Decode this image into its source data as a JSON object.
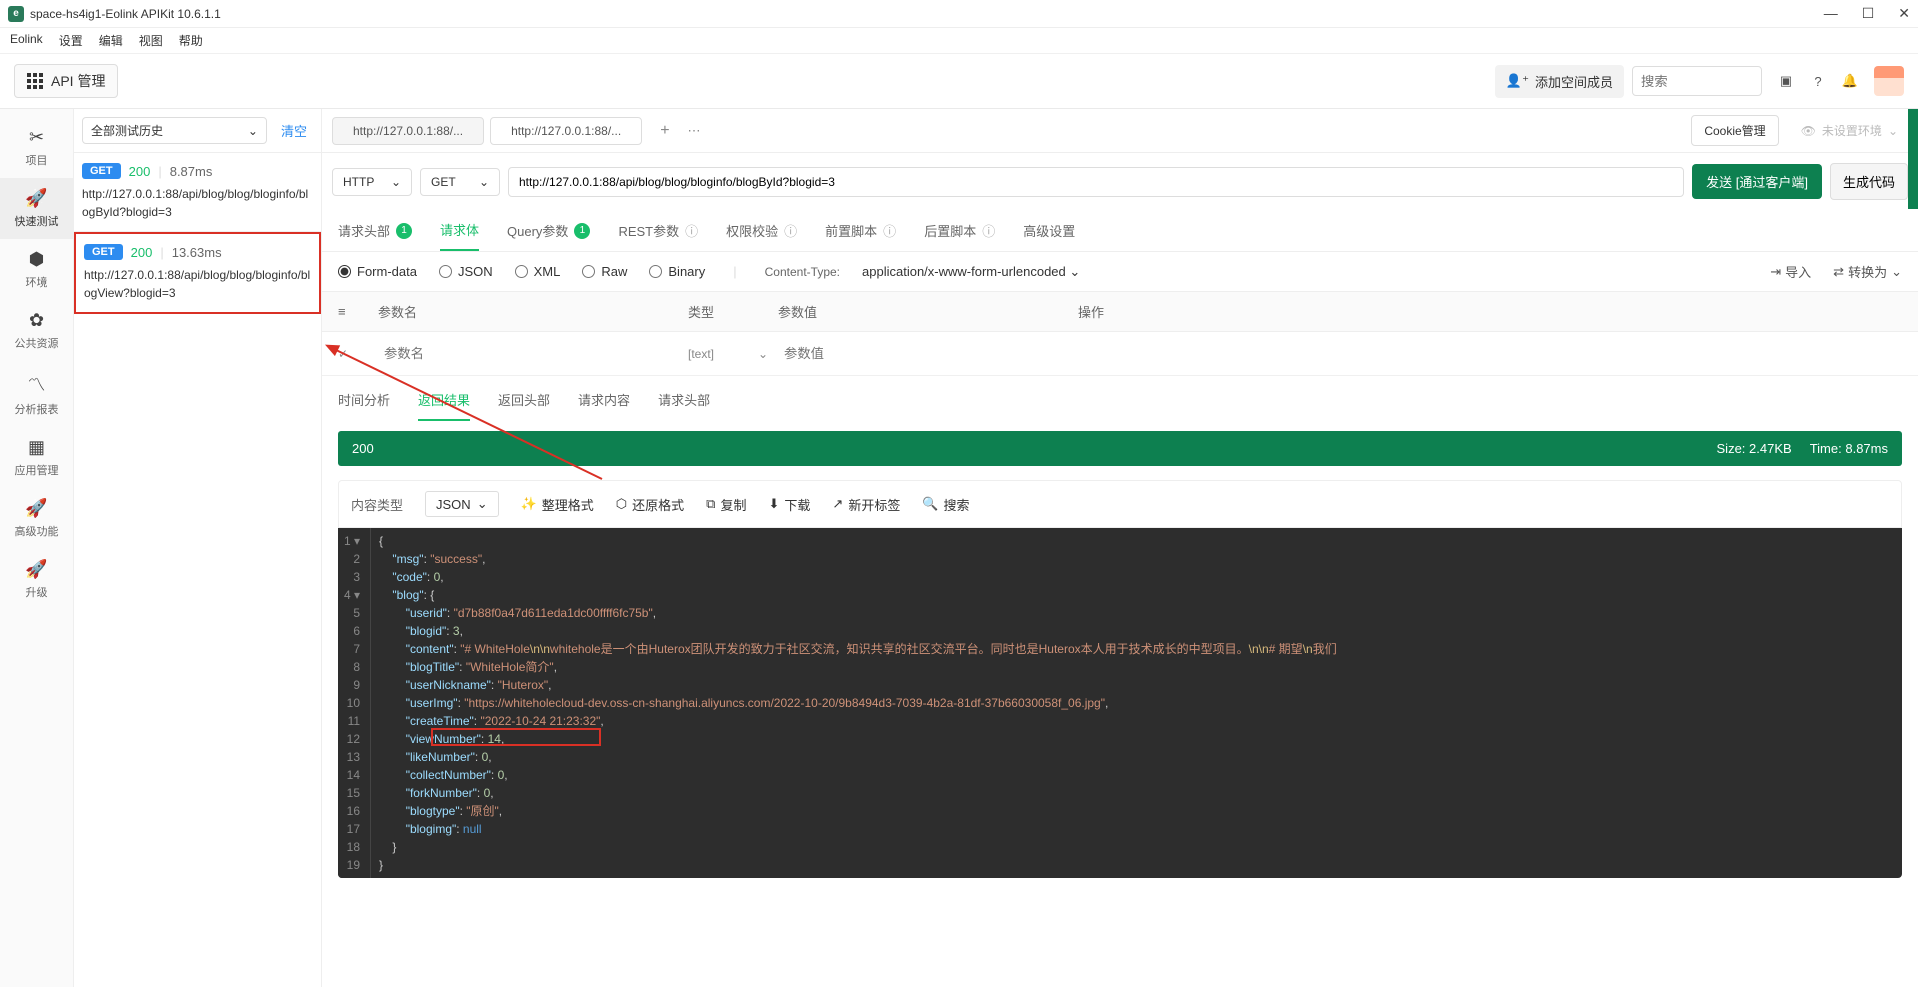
{
  "window": {
    "title": "space-hs4ig1-Eolink APIKit 10.6.1.1",
    "menu": [
      "Eolink",
      "设置",
      "编辑",
      "视图",
      "帮助"
    ]
  },
  "toolbar": {
    "api_mgmt": "API 管理",
    "add_member": "添加空间成员",
    "search_placeholder": "搜索"
  },
  "rail": [
    {
      "icon": "✕",
      "label": "项目"
    },
    {
      "icon": "🚀",
      "label": "快速测试"
    },
    {
      "icon": "⬡",
      "label": "环境"
    },
    {
      "icon": "⚙",
      "label": "公共资源"
    },
    {
      "icon": "📈",
      "label": "分析报表"
    },
    {
      "icon": "▦",
      "label": "应用管理"
    },
    {
      "icon": "🚀",
      "label": "高级功能"
    },
    {
      "icon": "🚀",
      "label": "升级"
    }
  ],
  "history": {
    "filter": "全部测试历史",
    "clear": "清空",
    "items": [
      {
        "method": "GET",
        "status": "200",
        "time": "8.87ms",
        "url": "http://127.0.0.1:88/api/blog/blog/bloginfo/blogById?blogid=3"
      },
      {
        "method": "GET",
        "status": "200",
        "time": "13.63ms",
        "url": "http://127.0.0.1:88/api/blog/blog/bloginfo/blogView?blogid=3"
      }
    ]
  },
  "tabs": {
    "items": [
      "http://127.0.0.1:88/...",
      "http://127.0.0.1:88/..."
    ],
    "cookie": "Cookie管理",
    "env": "未设置环境"
  },
  "request": {
    "protocol": "HTTP",
    "method": "GET",
    "url": "http://127.0.0.1:88/api/blog/blog/bloginfo/blogById?blogid=3",
    "send": "发送 [通过客户端]",
    "gen_code": "生成代码",
    "tabs": {
      "headers": "请求头部",
      "headers_badge": "1",
      "body": "请求体",
      "query": "Query参数",
      "query_badge": "1",
      "rest": "REST参数",
      "auth": "权限校验",
      "pre": "前置脚本",
      "post": "后置脚本",
      "advanced": "高级设置"
    },
    "body_types": [
      "Form-data",
      "JSON",
      "XML",
      "Raw",
      "Binary"
    ],
    "content_type_label": "Content-Type:",
    "content_type_value": "application/x-www-form-urlencoded",
    "import": "导入",
    "convert": "转换为",
    "params_header": {
      "name": "参数名",
      "type": "类型",
      "value": "参数值",
      "action": "操作"
    },
    "param_placeholder": {
      "name": "参数名",
      "type": "[text]",
      "value": "参数值"
    }
  },
  "response": {
    "tabs": [
      "时间分析",
      "返回结果",
      "返回头部",
      "请求内容",
      "请求头部"
    ],
    "status_code": "200",
    "size_label": "Size:",
    "size": "2.47KB",
    "time_label": "Time:",
    "time": "8.87ms",
    "content_type_label": "内容类型",
    "format": "JSON",
    "actions": {
      "tidy": "整理格式",
      "restore": "还原格式",
      "copy": "复制",
      "download": "下载",
      "newtab": "新开标签",
      "search": "搜索"
    }
  },
  "json_body": {
    "msg": "success",
    "code": 0,
    "blog": {
      "userid": "d7b88f0a47d611eda1dc00ffff6fc75b",
      "blogid": 3,
      "content_pre": "# WhiteHole",
      "content_mid": "whitehole是一个由Huterox团队开发的致力于社区交流，知识共享的社区交流平台。同时也是Huterox本人用于技术成长的中型项目。",
      "content_post": "# 期望",
      "content_tail": "我们",
      "blogTitle": "WhiteHole简介",
      "userNickname": "Huterox",
      "userImg": "https://whiteholecloud-dev.oss-cn-shanghai.aliyuncs.com/2022-10-20/9b8494d3-7039-4b2a-81df-37b66030058f_06.jpg",
      "createTime": "2022-10-24 21:23:32",
      "viewNumber": 14,
      "likeNumber": 0,
      "collectNumber": 0,
      "forkNumber": 0,
      "blogtype": "原创",
      "blogimg": "null"
    }
  }
}
